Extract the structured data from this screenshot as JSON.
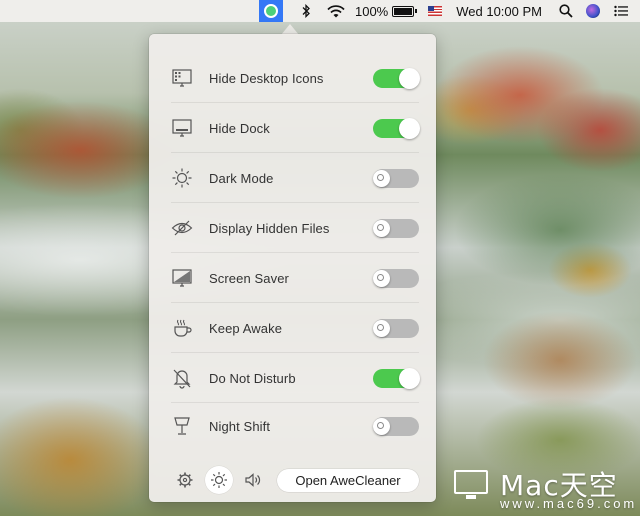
{
  "menubar": {
    "app_icon": "awecleaner-status-icon",
    "bluetooth_icon": "bluetooth-icon",
    "wifi_icon": "wifi-icon",
    "battery_percent": "100%",
    "battery_icon": "battery-charging-icon",
    "input_source_icon": "us-flag-icon",
    "clock": "Wed 10:00 PM",
    "search_icon": "spotlight-search-icon",
    "siri_icon": "siri-icon",
    "notification_icon": "notification-center-icon"
  },
  "panel": {
    "items": [
      {
        "label": "Hide Desktop Icons",
        "icon": "desktop-icons-icon",
        "enabled": true
      },
      {
        "label": "Hide Dock",
        "icon": "dock-icon",
        "enabled": true
      },
      {
        "label": "Dark Mode",
        "icon": "sun-icon",
        "enabled": false
      },
      {
        "label": "Display Hidden Files",
        "icon": "eye-hidden-icon",
        "enabled": false
      },
      {
        "label": "Screen Saver",
        "icon": "screen-saver-icon",
        "enabled": false
      },
      {
        "label": "Keep Awake",
        "icon": "coffee-cup-icon",
        "enabled": false
      },
      {
        "label": "Do Not Disturb",
        "icon": "bell-slash-icon",
        "enabled": true
      },
      {
        "label": "Night Shift",
        "icon": "lamp-icon",
        "enabled": false
      }
    ],
    "footer": {
      "settings_icon": "gear-icon",
      "brightness_icon": "brightness-icon",
      "volume_icon": "volume-icon",
      "open_button_label": "Open AweCleaner"
    }
  },
  "watermark": {
    "title": "Mac天空",
    "subtitle": "www.mac69.com"
  },
  "colors": {
    "toggle_on": "#4cc94e",
    "toggle_off": "#b9b9b9",
    "menubar_app_highlight": "#3478f6"
  }
}
